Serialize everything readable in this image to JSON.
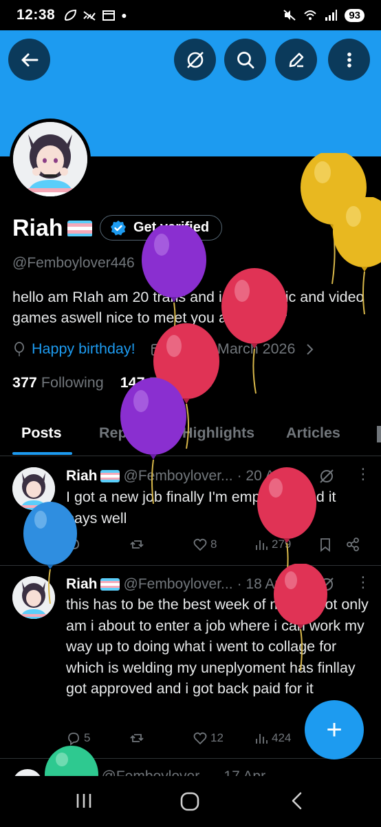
{
  "status_bar": {
    "time": "12:38",
    "battery": "93"
  },
  "header": {
    "back_icon": "arrow-left-icon",
    "grok_icon": "grok-icon",
    "search_icon": "search-icon",
    "edit_icon": "pencil-icon",
    "more_icon": "vertical-dots-icon",
    "banner_color": "#1d9bf0"
  },
  "profile": {
    "display_name": "Riah",
    "handle": "@Femboylover446",
    "get_verified_label": "Get verified",
    "bio": "hello am RIah am 20 trans and i love music and video games aswell nice to meet you all she/her",
    "birthday_link": "Happy birthday!",
    "joined": "Joined March 2026",
    "following_count": "377",
    "following_label": "Following",
    "followers_count": "147",
    "followers_label": "Followers"
  },
  "tabs": [
    {
      "label": "Posts"
    },
    {
      "label": "Replies"
    },
    {
      "label": "Highlights"
    },
    {
      "label": "Articles"
    }
  ],
  "posts": [
    {
      "name": "Riah",
      "handle": "@Femboylover...",
      "date": "· 20 Apr",
      "text": "I got a new job finally I'm employed and it pays well",
      "replies": "",
      "reposts": "",
      "likes": "8",
      "views": "279"
    },
    {
      "name": "Riah",
      "handle": "@Femboylover...",
      "date": "· 18 Apr",
      "text": "this has to be the best week of my life not only am i about to enter  a job where i can work my way up to doing what i went to collage for which is welding my uneplyoment has finllay got approved and i got back paid for it",
      "replies": "5",
      "reposts": "",
      "likes": "12",
      "views": "424"
    },
    {
      "name": "Riah",
      "handle": "@Femboylover...",
      "date": "· 17 Apr"
    }
  ],
  "fab": {
    "label": "+"
  },
  "colors": {
    "accent": "#1d9bf0",
    "balloon_purple": "#8a2fd0",
    "balloon_red": "#e03355",
    "balloon_gold": "#e8b820",
    "balloon_blue": "#2f8ee0",
    "balloon_green": "#2ec990"
  }
}
